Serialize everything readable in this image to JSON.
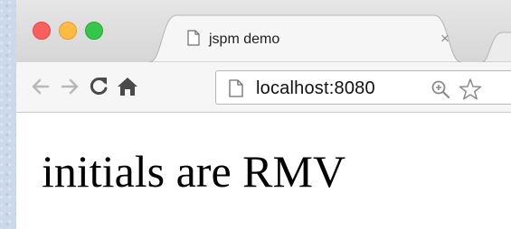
{
  "browser": {
    "tab": {
      "title": "jspm demo",
      "close_glyph": "×"
    },
    "address_bar": {
      "url": "localhost:8080"
    },
    "icons": {
      "back": "back-arrow-icon",
      "forward": "forward-arrow-icon",
      "reload": "reload-icon",
      "home": "home-icon",
      "page": "page-icon",
      "zoom": "zoom-in-icon",
      "bookmark": "star-icon"
    },
    "colors": {
      "close": "#fc605c",
      "minimize": "#fdbc40",
      "zoom": "#34c84a"
    }
  },
  "page": {
    "heading": "initials are RMV"
  }
}
